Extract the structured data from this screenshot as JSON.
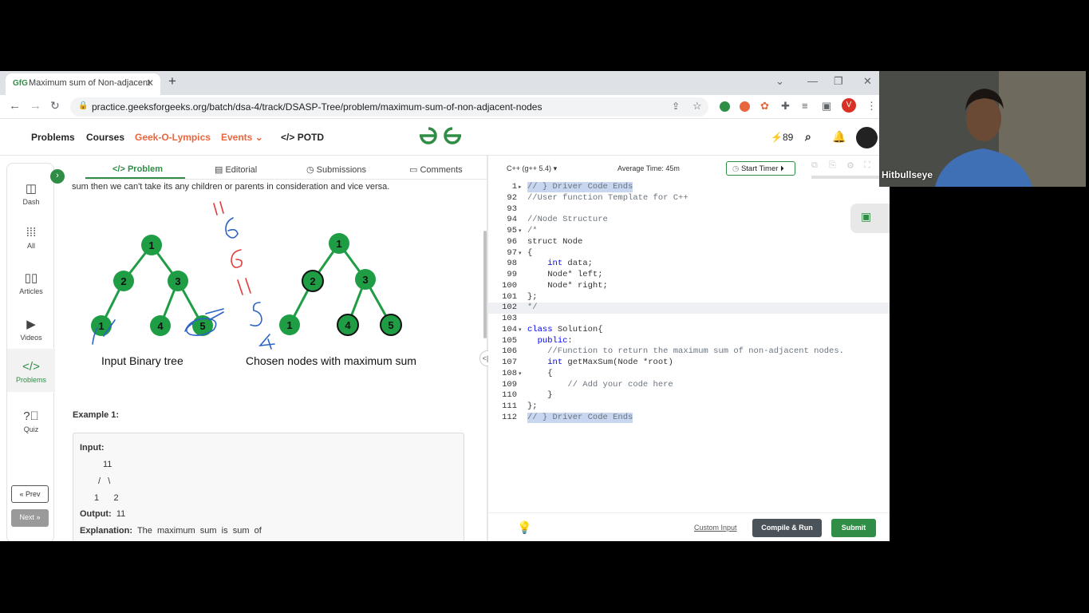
{
  "browser": {
    "tab_title": "Maximum sum of Non-adjacent",
    "tab_favicon": "GfG",
    "url": "practice.geeksforgeeks.org/batch/dsa-4/track/DSASP-Tree/problem/maximum-sum-of-non-adjacent-nodes",
    "profile_initial": "V"
  },
  "site_header": {
    "nav": [
      "Problems",
      "Courses",
      "Geek-O-Lympics",
      "Events",
      "POTD"
    ],
    "logo": "GfG",
    "streak": "89"
  },
  "sidebar": {
    "items": [
      {
        "label": "Dash",
        "icon": "dashboard-icon"
      },
      {
        "label": "All",
        "icon": "grid-icon"
      },
      {
        "label": "Articles",
        "icon": "book-icon"
      },
      {
        "label": "Videos",
        "icon": "video-icon"
      },
      {
        "label": "Problems",
        "icon": "code-icon"
      },
      {
        "label": "Quiz",
        "icon": "question-icon"
      }
    ],
    "prev": "« Prev",
    "next": "Next »"
  },
  "problem_tabs": [
    "Problem",
    "Editorial",
    "Submissions",
    "Comments"
  ],
  "problem": {
    "intro_text": "sum then we can't take its any children or parents in consideration and vice versa.",
    "figure_caption_left": "Input Binary tree",
    "figure_caption_right": "Chosen nodes with maximum sum",
    "tree_left_nodes": [
      "1",
      "2",
      "3",
      "1",
      "4",
      "5"
    ],
    "tree_right_nodes": [
      "1",
      "2",
      "3",
      "1",
      "4",
      "5"
    ],
    "example_heading": "Example 1:",
    "example": {
      "input_label": "Input:",
      "tree_lines": [
        "11",
        "/   \\",
        "1      2"
      ],
      "output_label": "Output:",
      "output_value": "11",
      "explanation_label": "Explanation:",
      "explanation_text": "The  maximum  sum  is  sum  of"
    }
  },
  "editor": {
    "language": "C++ (g++ 5.4)",
    "average_time": "Average Time: 45m",
    "start_timer": "Start Timer",
    "line_numbers": [
      "1",
      "92",
      "93",
      "94",
      "95",
      "96",
      "97",
      "98",
      "99",
      "100",
      "101",
      "102",
      "103",
      "104",
      "105",
      "106",
      "107",
      "108",
      "109",
      "110",
      "111",
      "112"
    ],
    "code_lines": [
      "// } Driver Code Ends",
      "//User function Template for C++",
      "",
      "//Node Structure",
      "/*",
      "struct Node",
      "{",
      "    int data;",
      "    Node* left;",
      "    Node* right;",
      "};",
      "*/",
      "",
      "class Solution{",
      "  public:",
      "    //Function to return the maximum sum of non-adjacent nodes.",
      "    int getMaxSum(Node *root)",
      "    {",
      "        // Add your code here",
      "    }",
      "};",
      "// } Driver Code Ends"
    ],
    "custom_input": "Custom Input",
    "compile_run": "Compile & Run",
    "submit": "Submit"
  },
  "webcam": {
    "name": "Hitbullseye"
  },
  "colors": {
    "brand_green": "#2f8d46",
    "node_green": "#1f9d45",
    "dark_button": "#4a525a",
    "annotation_red": "#e23b3b",
    "annotation_blue": "#2b63c6"
  }
}
